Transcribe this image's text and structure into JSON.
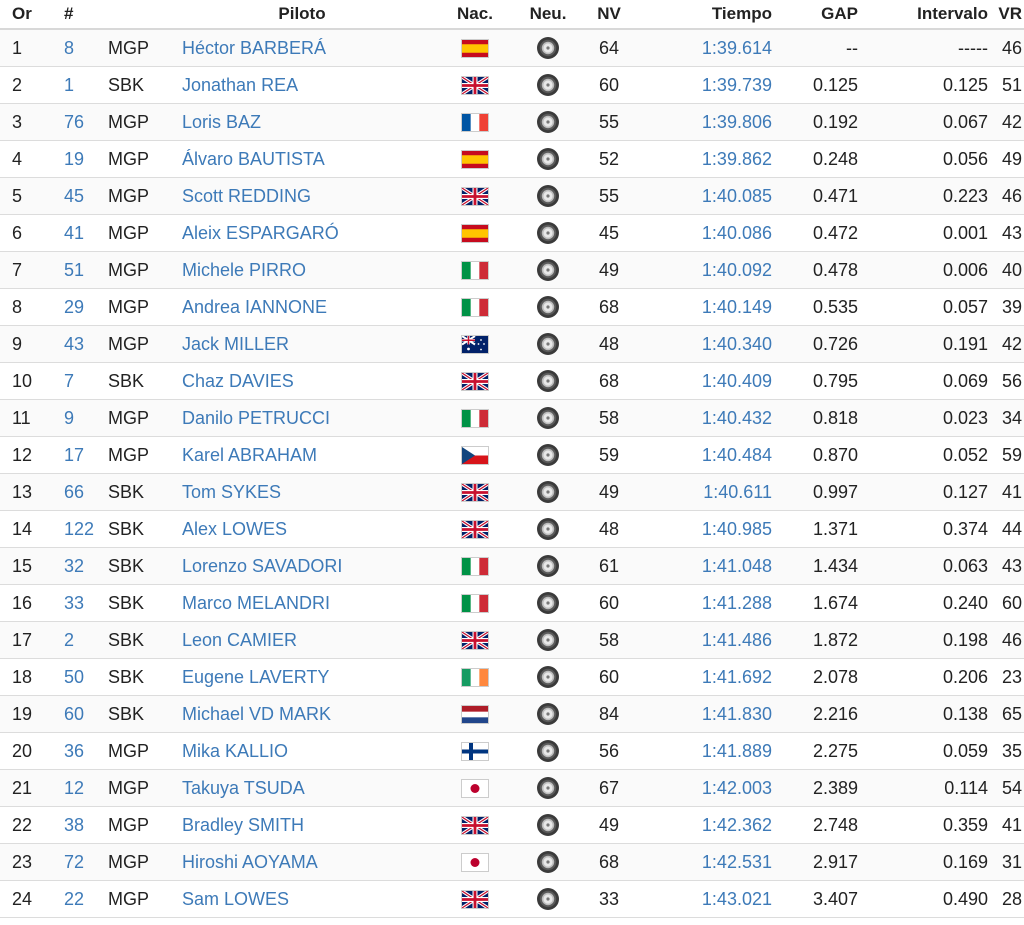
{
  "headers": {
    "pos": "Or",
    "num": "#",
    "piloto": "Piloto",
    "nac": "Nac.",
    "neu": "Neu.",
    "nv": "NV",
    "tiempo": "Tiempo",
    "gap": "GAP",
    "intervalo": "Intervalo",
    "vr": "VR"
  },
  "colors": {
    "link": "#3d7ab8",
    "text": "#222222",
    "border": "#dcdcdc"
  },
  "rows": [
    {
      "pos": "1",
      "num": "8",
      "cat": "MGP",
      "rider": "Héctor BARBERÁ",
      "nation": "ESP",
      "tyre": "tyre-icon",
      "laps": "64",
      "time": "1:39.614",
      "gap": "--",
      "interval": "-----",
      "vr": "46"
    },
    {
      "pos": "2",
      "num": "1",
      "cat": "SBK",
      "rider": "Jonathan REA",
      "nation": "GBR",
      "tyre": "tyre-icon",
      "laps": "60",
      "time": "1:39.739",
      "gap": "0.125",
      "interval": "0.125",
      "vr": "51"
    },
    {
      "pos": "3",
      "num": "76",
      "cat": "MGP",
      "rider": "Loris BAZ",
      "nation": "FRA",
      "tyre": "tyre-icon",
      "laps": "55",
      "time": "1:39.806",
      "gap": "0.192",
      "interval": "0.067",
      "vr": "42"
    },
    {
      "pos": "4",
      "num": "19",
      "cat": "MGP",
      "rider": "Álvaro BAUTISTA",
      "nation": "ESP",
      "tyre": "tyre-icon",
      "laps": "52",
      "time": "1:39.862",
      "gap": "0.248",
      "interval": "0.056",
      "vr": "49"
    },
    {
      "pos": "5",
      "num": "45",
      "cat": "MGP",
      "rider": "Scott REDDING",
      "nation": "GBR",
      "tyre": "tyre-icon",
      "laps": "55",
      "time": "1:40.085",
      "gap": "0.471",
      "interval": "0.223",
      "vr": "46"
    },
    {
      "pos": "6",
      "num": "41",
      "cat": "MGP",
      "rider": "Aleix ESPARGARÓ",
      "nation": "ESP",
      "tyre": "tyre-icon",
      "laps": "45",
      "time": "1:40.086",
      "gap": "0.472",
      "interval": "0.001",
      "vr": "43"
    },
    {
      "pos": "7",
      "num": "51",
      "cat": "MGP",
      "rider": "Michele PIRRO",
      "nation": "ITA",
      "tyre": "tyre-icon",
      "laps": "49",
      "time": "1:40.092",
      "gap": "0.478",
      "interval": "0.006",
      "vr": "40"
    },
    {
      "pos": "8",
      "num": "29",
      "cat": "MGP",
      "rider": "Andrea IANNONE",
      "nation": "ITA",
      "tyre": "tyre-icon",
      "laps": "68",
      "time": "1:40.149",
      "gap": "0.535",
      "interval": "0.057",
      "vr": "39"
    },
    {
      "pos": "9",
      "num": "43",
      "cat": "MGP",
      "rider": "Jack MILLER",
      "nation": "AUS",
      "tyre": "tyre-icon",
      "laps": "48",
      "time": "1:40.340",
      "gap": "0.726",
      "interval": "0.191",
      "vr": "42"
    },
    {
      "pos": "10",
      "num": "7",
      "cat": "SBK",
      "rider": "Chaz DAVIES",
      "nation": "GBR",
      "tyre": "tyre-icon",
      "laps": "68",
      "time": "1:40.409",
      "gap": "0.795",
      "interval": "0.069",
      "vr": "56"
    },
    {
      "pos": "11",
      "num": "9",
      "cat": "MGP",
      "rider": "Danilo PETRUCCI",
      "nation": "ITA",
      "tyre": "tyre-icon",
      "laps": "58",
      "time": "1:40.432",
      "gap": "0.818",
      "interval": "0.023",
      "vr": "34"
    },
    {
      "pos": "12",
      "num": "17",
      "cat": "MGP",
      "rider": "Karel ABRAHAM",
      "nation": "CZE",
      "tyre": "tyre-icon",
      "laps": "59",
      "time": "1:40.484",
      "gap": "0.870",
      "interval": "0.052",
      "vr": "59"
    },
    {
      "pos": "13",
      "num": "66",
      "cat": "SBK",
      "rider": "Tom SYKES",
      "nation": "GBR",
      "tyre": "tyre-icon",
      "laps": "49",
      "time": "1:40.611",
      "gap": "0.997",
      "interval": "0.127",
      "vr": "41"
    },
    {
      "pos": "14",
      "num": "122",
      "cat": "SBK",
      "rider": "Alex LOWES",
      "nation": "GBR",
      "tyre": "tyre-icon",
      "laps": "48",
      "time": "1:40.985",
      "gap": "1.371",
      "interval": "0.374",
      "vr": "44"
    },
    {
      "pos": "15",
      "num": "32",
      "cat": "SBK",
      "rider": "Lorenzo SAVADORI",
      "nation": "ITA",
      "tyre": "tyre-icon",
      "laps": "61",
      "time": "1:41.048",
      "gap": "1.434",
      "interval": "0.063",
      "vr": "43"
    },
    {
      "pos": "16",
      "num": "33",
      "cat": "SBK",
      "rider": "Marco MELANDRI",
      "nation": "ITA",
      "tyre": "tyre-icon",
      "laps": "60",
      "time": "1:41.288",
      "gap": "1.674",
      "interval": "0.240",
      "vr": "60"
    },
    {
      "pos": "17",
      "num": "2",
      "cat": "SBK",
      "rider": "Leon CAMIER",
      "nation": "GBR",
      "tyre": "tyre-icon",
      "laps": "58",
      "time": "1:41.486",
      "gap": "1.872",
      "interval": "0.198",
      "vr": "46"
    },
    {
      "pos": "18",
      "num": "50",
      "cat": "SBK",
      "rider": "Eugene LAVERTY",
      "nation": "IRL",
      "tyre": "tyre-icon",
      "laps": "60",
      "time": "1:41.692",
      "gap": "2.078",
      "interval": "0.206",
      "vr": "23"
    },
    {
      "pos": "19",
      "num": "60",
      "cat": "SBK",
      "rider": "Michael VD MARK",
      "nation": "NED",
      "tyre": "tyre-icon",
      "laps": "84",
      "time": "1:41.830",
      "gap": "2.216",
      "interval": "0.138",
      "vr": "65"
    },
    {
      "pos": "20",
      "num": "36",
      "cat": "MGP",
      "rider": "Mika KALLIO",
      "nation": "FIN",
      "tyre": "tyre-icon",
      "laps": "56",
      "time": "1:41.889",
      "gap": "2.275",
      "interval": "0.059",
      "vr": "35"
    },
    {
      "pos": "21",
      "num": "12",
      "cat": "MGP",
      "rider": "Takuya TSUDA",
      "nation": "JPN",
      "tyre": "tyre-icon",
      "laps": "67",
      "time": "1:42.003",
      "gap": "2.389",
      "interval": "0.114",
      "vr": "54"
    },
    {
      "pos": "22",
      "num": "38",
      "cat": "MGP",
      "rider": "Bradley SMITH",
      "nation": "GBR",
      "tyre": "tyre-icon",
      "laps": "49",
      "time": "1:42.362",
      "gap": "2.748",
      "interval": "0.359",
      "vr": "41"
    },
    {
      "pos": "23",
      "num": "72",
      "cat": "MGP",
      "rider": "Hiroshi AOYAMA",
      "nation": "JPN",
      "tyre": "tyre-icon",
      "laps": "68",
      "time": "1:42.531",
      "gap": "2.917",
      "interval": "0.169",
      "vr": "31"
    },
    {
      "pos": "24",
      "num": "22",
      "cat": "MGP",
      "rider": "Sam LOWES",
      "nation": "GBR",
      "tyre": "tyre-icon",
      "laps": "33",
      "time": "1:43.021",
      "gap": "3.407",
      "interval": "0.490",
      "vr": "28"
    }
  ]
}
